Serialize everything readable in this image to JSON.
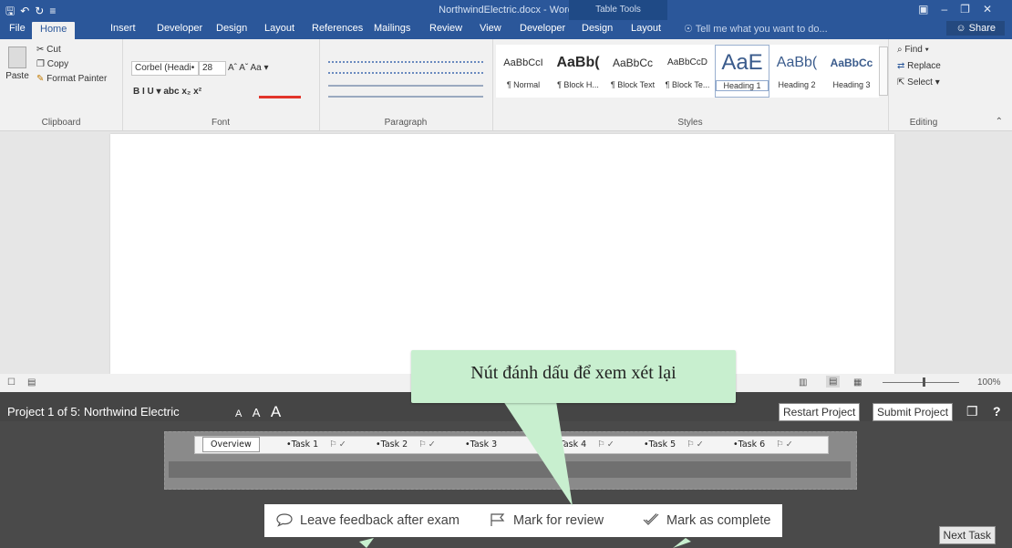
{
  "titlebar": {
    "doc_title": "NorthwindElectric.docx - Word",
    "context_group": "Table Tools",
    "qat_icons": [
      "save-icon",
      "undo-icon",
      "redo-icon",
      "customize-icon"
    ],
    "window_controls": [
      "ribbon-options-icon",
      "minimize-icon",
      "maximize-icon",
      "close-icon"
    ]
  },
  "tabs": {
    "items": [
      "File",
      "Home",
      "Insert",
      "Developer",
      "Design",
      "Layout",
      "References",
      "Mailings",
      "Review",
      "View",
      "Developer",
      "Design",
      "Layout"
    ],
    "active": "Home",
    "tell_me": "Tell me what you want to do...",
    "share": "Share"
  },
  "ribbon": {
    "clipboard": {
      "label": "Clipboard",
      "paste": "Paste",
      "cut": "Cut",
      "copy": "Copy",
      "format_painter": "Format Painter"
    },
    "font": {
      "label": "Font",
      "font_name": "Corbel (Headi•",
      "font_size": "28",
      "row1": "Aˆ  Aˇ  Aa ▾",
      "row2": "B  I  U ▾  abc  x₂  x²"
    },
    "paragraph": {
      "label": "Paragraph"
    },
    "styles": {
      "label": "Styles",
      "items": [
        {
          "preview": "AaBbCcI",
          "name": "¶ Normal"
        },
        {
          "preview": "AaBb(",
          "name": "¶ Block H..."
        },
        {
          "preview": "AaBbCc",
          "name": "¶ Block Text"
        },
        {
          "preview": "AaBbCcD",
          "name": "¶ Block Te..."
        },
        {
          "preview": "AaE",
          "name": "Heading 1"
        },
        {
          "preview": "AaBb(",
          "name": "Heading 2"
        },
        {
          "preview": "AaBbCc",
          "name": "Heading 3"
        }
      ],
      "selected": "Heading 1"
    },
    "editing": {
      "label": "Editing",
      "find": "Find",
      "replace": "Replace",
      "select": "Select"
    }
  },
  "statusbar": {
    "zoom": "100%"
  },
  "exam": {
    "project_title": "Project 1 of 5: Northwind Electric",
    "font_size_controls": [
      "A",
      "A",
      "A"
    ],
    "restart": "Restart Project",
    "submit": "Submit Project",
    "help": "?",
    "task_tabs": [
      "Overview",
      "•Task 1",
      "•Task 2",
      "•Task 3",
      "•Task 4",
      "•Task 5",
      "•Task 6"
    ],
    "actions": {
      "feedback": "Leave feedback after exam",
      "review": "Mark for review",
      "complete": "Mark as complete"
    },
    "next_task": "Next Task"
  },
  "callout": {
    "text": "Nút đánh dấu để xem xét lại",
    "color": "#c8efcf"
  },
  "colors": {
    "word_blue": "#2b579a",
    "exam_panel": "#4a4a4a"
  }
}
